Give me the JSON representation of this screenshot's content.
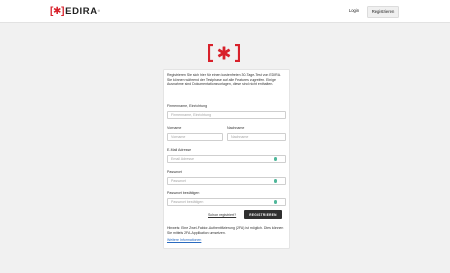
{
  "header": {
    "brand_mark": "[✱]",
    "brand_name": "EDIRA",
    "brand_reg": "®",
    "login_label": "Login",
    "register_label": "Registrieren"
  },
  "colors": {
    "brand_red": "#d8212b",
    "field_icon_green": "#4fb79a",
    "submit_bg": "#2f2f2f",
    "link_blue": "#2a6bc0"
  },
  "form": {
    "intro": "Registrieren Sie sich hier für einen kostenfreien 30-Tage-Test von EDIRA. Sie können während der Testphase auf alle Features zugreifen. Einige Ausnahme sind Dokumentationsvorlagen, diese sind nicht enthalten.",
    "company_label": "Firmenname, Einrichtung",
    "company_placeholder": "Firmenname, Einrichtung",
    "firstname_label": "Vorname",
    "firstname_placeholder": "Vorname",
    "lastname_label": "Nachname",
    "lastname_placeholder": "Nachname",
    "email_label": "E-Mail Adresse",
    "email_placeholder": "Email Adresse",
    "password_label": "Passwort",
    "password_placeholder": "Passwort",
    "password_confirm_label": "Passwort bestätigen",
    "password_confirm_placeholder": "Passwort bestätigen",
    "already_registered": "Schon registriert?",
    "submit_label": "REGISTRIEREN",
    "hint": "Hinweis: Eine Zwei-Faktor-Authentifizierung (2FA) ist möglich. Dies können Sie mittels 2FA-Applikation umsetzen.",
    "more_info": "Weitere Informationen"
  }
}
